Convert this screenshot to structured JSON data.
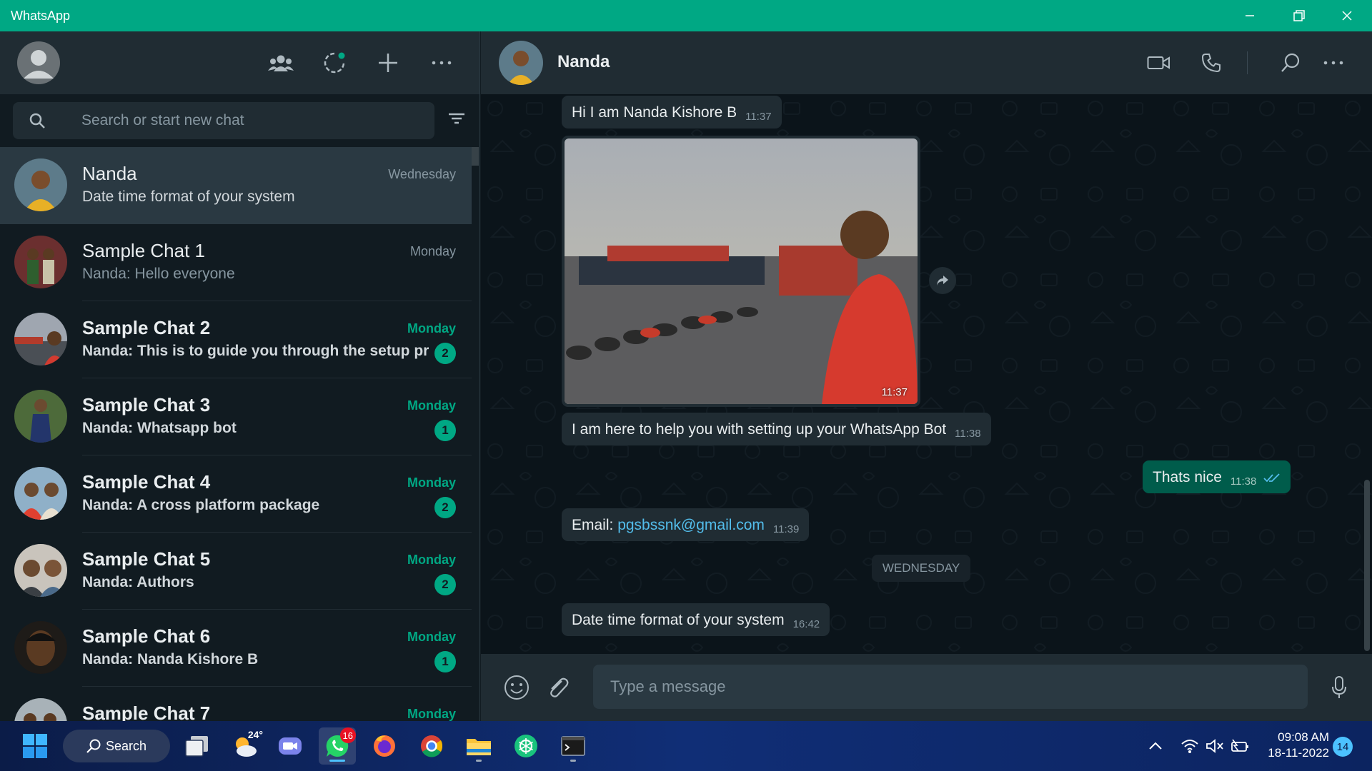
{
  "window": {
    "title": "WhatsApp"
  },
  "sidebar": {
    "header_icons": [
      "community-icon",
      "status-icon",
      "new-chat-icon",
      "menu-icon"
    ],
    "search": {
      "placeholder": "Search or start new chat",
      "value": ""
    },
    "chats": [
      {
        "name": "Nanda",
        "preview": "Date time format of your system",
        "time": "Wednesday",
        "unread": "",
        "active": true
      },
      {
        "name": "Sample Chat 1",
        "preview": "Nanda: Hello everyone",
        "time": "Monday",
        "unread": ""
      },
      {
        "name": "Sample Chat 2",
        "preview": "Nanda: This is to guide you through the setup pr...",
        "time": "Monday",
        "unread": "2"
      },
      {
        "name": "Sample Chat 3",
        "preview": "Nanda: Whatsapp bot",
        "time": "Monday",
        "unread": "1"
      },
      {
        "name": "Sample Chat 4",
        "preview": "Nanda: A cross platform package",
        "time": "Monday",
        "unread": "2"
      },
      {
        "name": "Sample Chat 5",
        "preview": "Nanda: Authors",
        "time": "Monday",
        "unread": "2"
      },
      {
        "name": "Sample Chat 6",
        "preview": "Nanda: Nanda Kishore B",
        "time": "Monday",
        "unread": "1"
      },
      {
        "name": "Sample Chat 7",
        "preview": "",
        "time": "Monday",
        "unread": ""
      }
    ]
  },
  "conversation": {
    "contact_name": "Nanda",
    "messages": [
      {
        "text": "Hi I am Nanda Kishore B",
        "time": "11:37"
      },
      {
        "image_time": "11:37"
      },
      {
        "text": "I am here to help you with setting up your WhatsApp Bot",
        "time": "11:38"
      },
      {
        "text": "Thats nice",
        "time": "11:38",
        "outgoing": true
      },
      {
        "label": "Email: ",
        "link": "pgsbssnk@gmail.com",
        "time": "11:39"
      },
      {
        "date_separator": "WEDNESDAY"
      },
      {
        "text": "Date time format of your system",
        "time": "16:42"
      }
    ],
    "composer": {
      "placeholder": "Type a message",
      "value": ""
    }
  },
  "taskbar": {
    "search_label": "Search",
    "weather_temp": "24°",
    "whatsapp_badge": "16",
    "clock_time": "09:08 AM",
    "clock_date": "18-11-2022",
    "notification_count": "14"
  },
  "colors": {
    "accent": "#00a884",
    "panel": "#202c33",
    "background": "#111b21",
    "outgoing_bubble": "#005c4b",
    "link": "#53bdeb"
  }
}
